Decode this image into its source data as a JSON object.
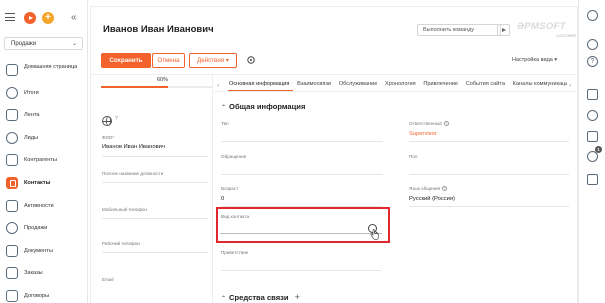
{
  "sidebar": {
    "workspace": "Продажи",
    "items": [
      {
        "label": "Домашняя страница",
        "icon": "home-icon"
      },
      {
        "label": "Итоги",
        "icon": "chart-icon"
      },
      {
        "label": "Лента",
        "icon": "feed-icon"
      },
      {
        "label": "Лиды",
        "icon": "leads-icon"
      },
      {
        "label": "Контрагенты",
        "icon": "accounts-icon"
      },
      {
        "label": "Контакты",
        "icon": "contacts-icon"
      },
      {
        "label": "Активности",
        "icon": "activities-icon"
      },
      {
        "label": "Продажи",
        "icon": "sales-icon"
      },
      {
        "label": "Документы",
        "icon": "documents-icon"
      },
      {
        "label": "Заказы",
        "icon": "orders-icon"
      },
      {
        "label": "Договоры",
        "icon": "contracts-icon"
      }
    ]
  },
  "header": {
    "title": "Иванов Иван Иванович",
    "command_placeholder": "Выполнить команду",
    "logo": "ƏPMSOFT",
    "logo_sub": "CUSTOMER"
  },
  "toolbar": {
    "save": "Сохранить",
    "cancel": "Отмена",
    "actions": "Действия",
    "view_settings": "Настройка вида"
  },
  "profile": {
    "completeness_label": "60%",
    "completeness": 0.6,
    "fio_label": "ФИО*",
    "fio_value": "Иванов Иван Иванович",
    "job_label": "Полное название должности",
    "mobile_label": "Мобильный телефон",
    "work_phone_label": "Рабочий телефон",
    "email_label": "Email"
  },
  "tabs": [
    "Основная информация",
    "Взаимосвязи",
    "Обслуживание",
    "Хронология",
    "Привлечение",
    "События сайта",
    "Каналы коммуникации"
  ],
  "general": {
    "title": "Общая информация",
    "type_label": "Тип",
    "owner_label": "Ответственный",
    "owner_value": "Supervisor",
    "salutation_label": "Обращение",
    "gender_label": "Пол",
    "age_label": "Возраст",
    "age_value": "0",
    "language_label": "Язык общения",
    "language_value": "Русский (Россия)",
    "contact_type_label": "Вид контакта",
    "greeting_label": "Приветствие"
  },
  "comms": {
    "title": "Средства связи"
  },
  "colors": {
    "accent": "#f3622a",
    "highlight": "#e0282e"
  }
}
